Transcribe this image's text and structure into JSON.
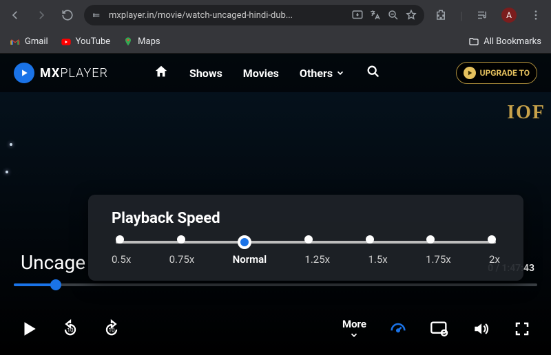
{
  "browser": {
    "url": "mxplayer.in/movie/watch-uncaged-hindi-dub...",
    "profile_initial": "A",
    "bookmarks": {
      "gmail": "Gmail",
      "youtube": "YouTube",
      "maps": "Maps",
      "all": "All Bookmarks"
    }
  },
  "mx": {
    "brand_bold": "MX",
    "brand_thin": "PLAYER",
    "nav": {
      "shows": "Shows",
      "movies": "Movies",
      "others": "Others"
    },
    "upgrade": "UPGRADE TO",
    "watermark": "IOF"
  },
  "video": {
    "title": "Uncage",
    "time_label": "0 / 1:47:43",
    "more": "More"
  },
  "speed": {
    "heading": "Playback Speed",
    "options": [
      "0.5x",
      "0.75x",
      "Normal",
      "1.25x",
      "1.5x",
      "1.75x",
      "2x"
    ],
    "selected_index": 2
  }
}
